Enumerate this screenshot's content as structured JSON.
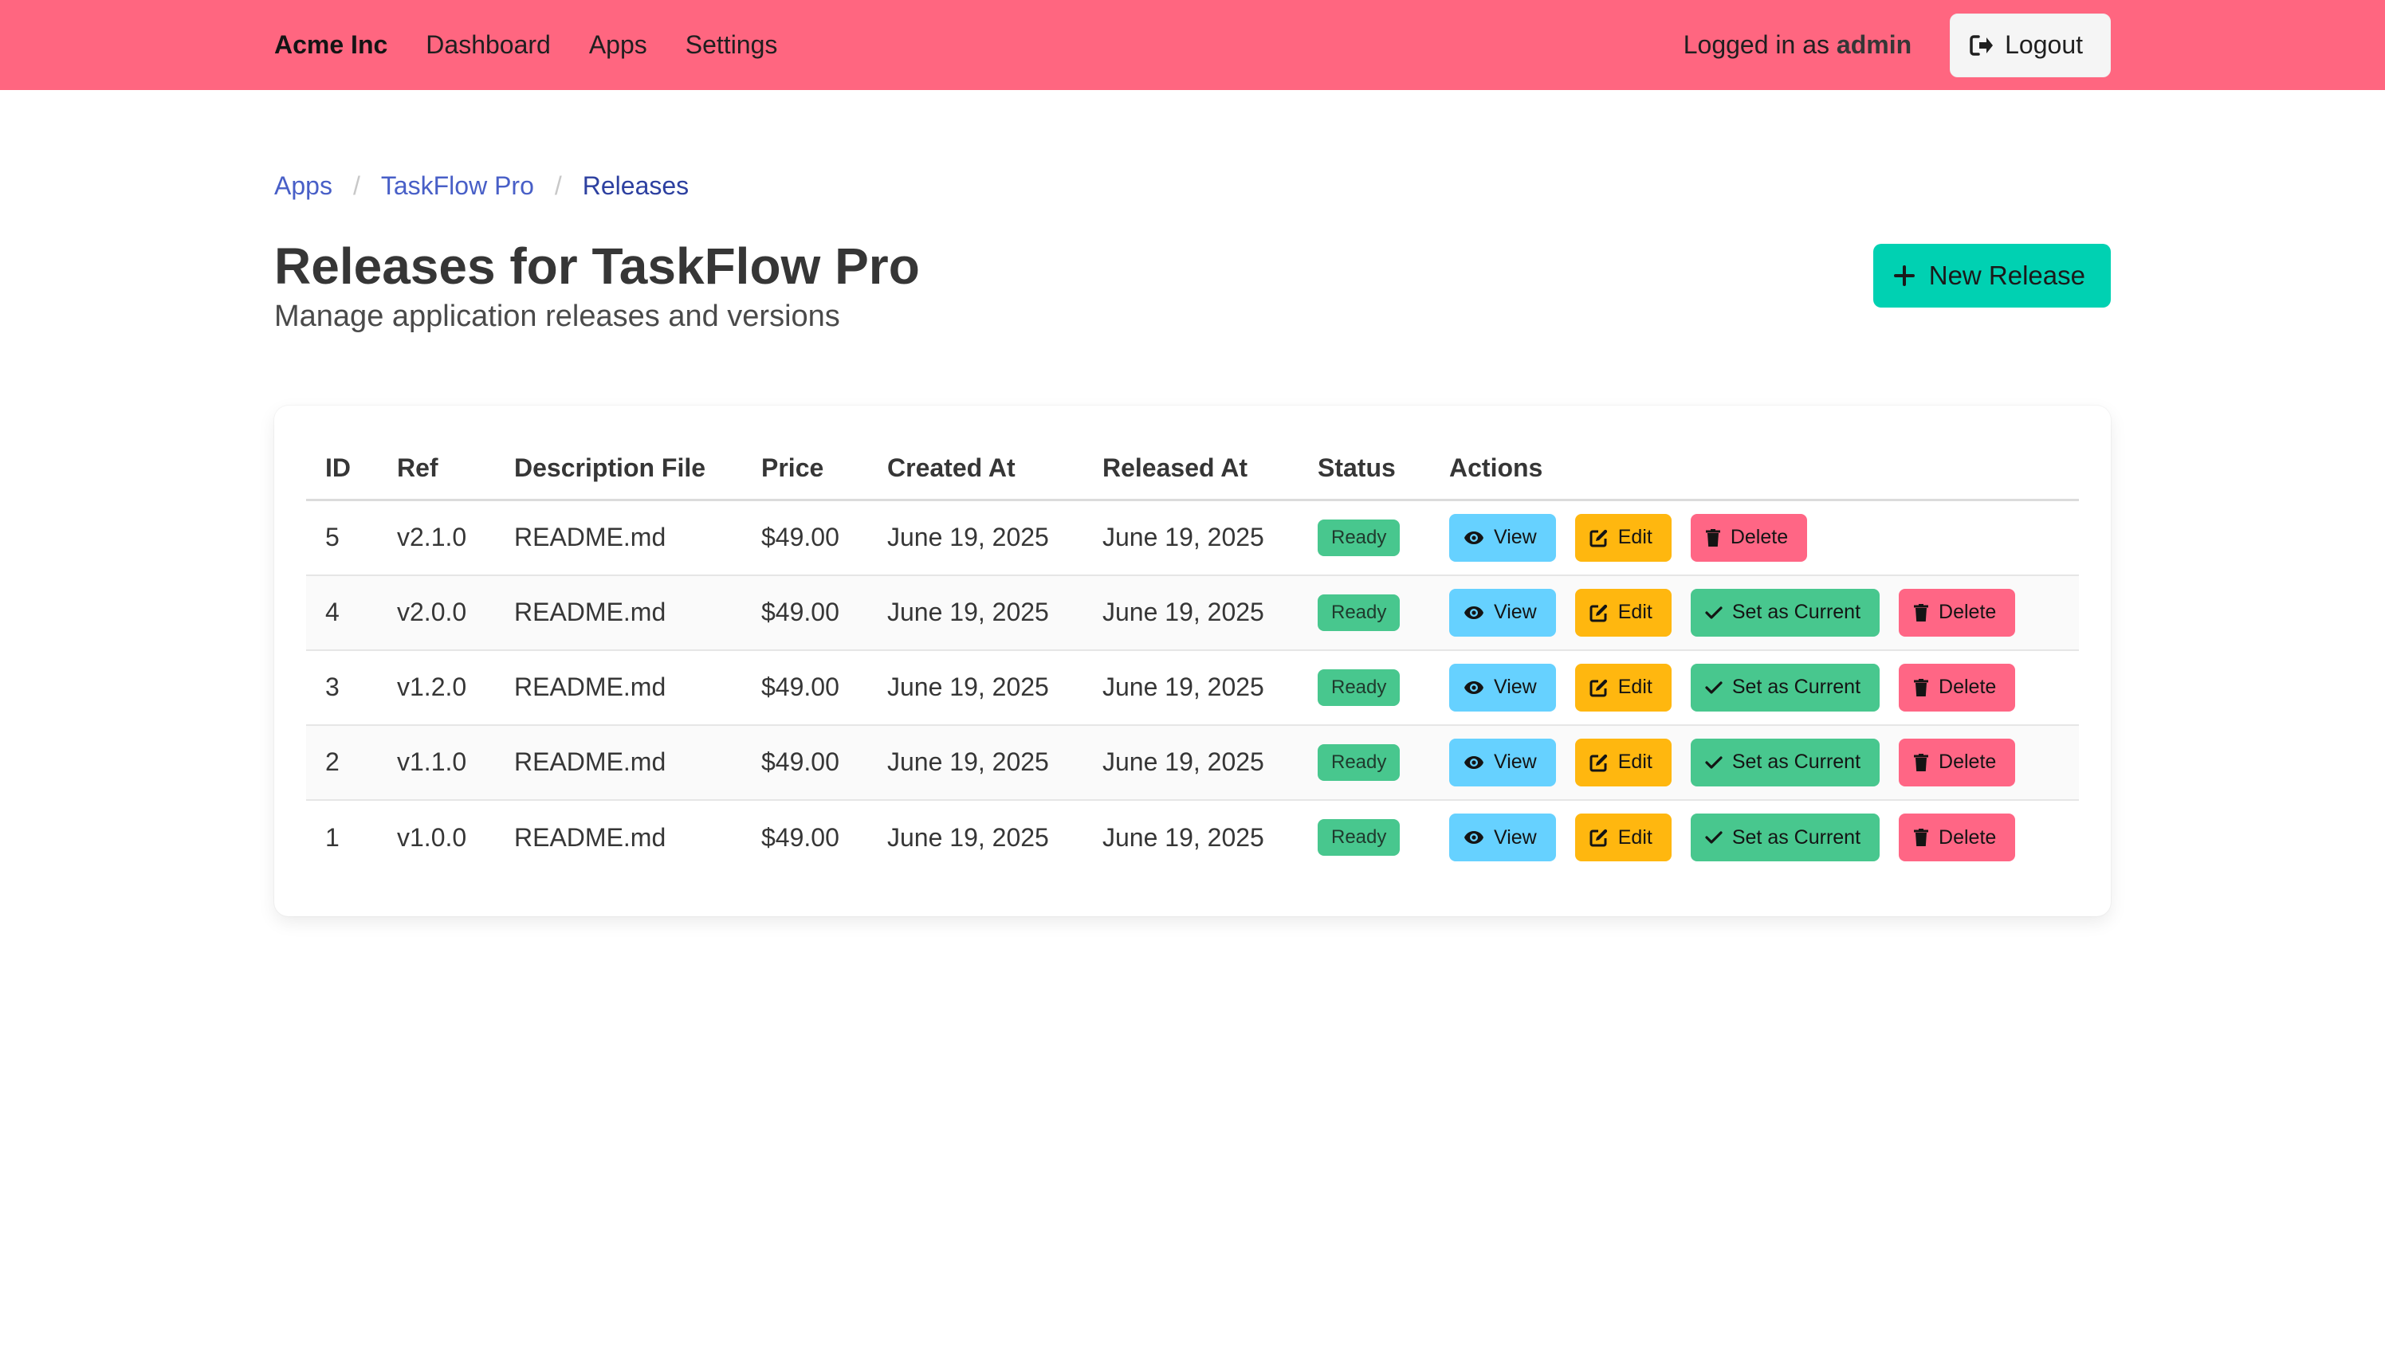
{
  "navbar": {
    "brand": "Acme Inc",
    "items": [
      "Dashboard",
      "Apps",
      "Settings"
    ],
    "logged_in_prefix": "Logged in as ",
    "username": "admin",
    "logout_label": "Logout"
  },
  "breadcrumb": [
    "Apps",
    "TaskFlow Pro",
    "Releases"
  ],
  "page": {
    "title": "Releases for TaskFlow Pro",
    "subtitle": "Manage application releases and versions",
    "new_release_label": "New Release"
  },
  "table": {
    "columns": [
      "ID",
      "Ref",
      "Description File",
      "Price",
      "Created At",
      "Released At",
      "Status",
      "Actions"
    ],
    "rows": [
      {
        "id": "5",
        "ref": "v2.1.0",
        "file": "README.md",
        "price": "$49.00",
        "created": "June 19, 2025",
        "released": "June 19, 2025",
        "status": "Ready",
        "is_current": true
      },
      {
        "id": "4",
        "ref": "v2.0.0",
        "file": "README.md",
        "price": "$49.00",
        "created": "June 19, 2025",
        "released": "June 19, 2025",
        "status": "Ready",
        "is_current": false
      },
      {
        "id": "3",
        "ref": "v1.2.0",
        "file": "README.md",
        "price": "$49.00",
        "created": "June 19, 2025",
        "released": "June 19, 2025",
        "status": "Ready",
        "is_current": false
      },
      {
        "id": "2",
        "ref": "v1.1.0",
        "file": "README.md",
        "price": "$49.00",
        "created": "June 19, 2025",
        "released": "June 19, 2025",
        "status": "Ready",
        "is_current": false
      },
      {
        "id": "1",
        "ref": "v1.0.0",
        "file": "README.md",
        "price": "$49.00",
        "created": "June 19, 2025",
        "released": "June 19, 2025",
        "status": "Ready",
        "is_current": false
      }
    ],
    "actions": {
      "view": "View",
      "edit": "Edit",
      "set_current": "Set as Current",
      "delete": "Delete"
    }
  },
  "colors": {
    "navbar": "#ff6680",
    "primary": "#00d1b2",
    "info": "#66d1ff",
    "warning": "#ffb70f",
    "success": "#48c78e",
    "danger": "#ff6685",
    "link": "#485fc7"
  },
  "icons": {
    "logout": "sign-out-icon",
    "new_release": "plus-icon",
    "view": "eye-icon",
    "edit": "edit-icon",
    "set_current": "check-icon",
    "delete": "trash-icon"
  }
}
